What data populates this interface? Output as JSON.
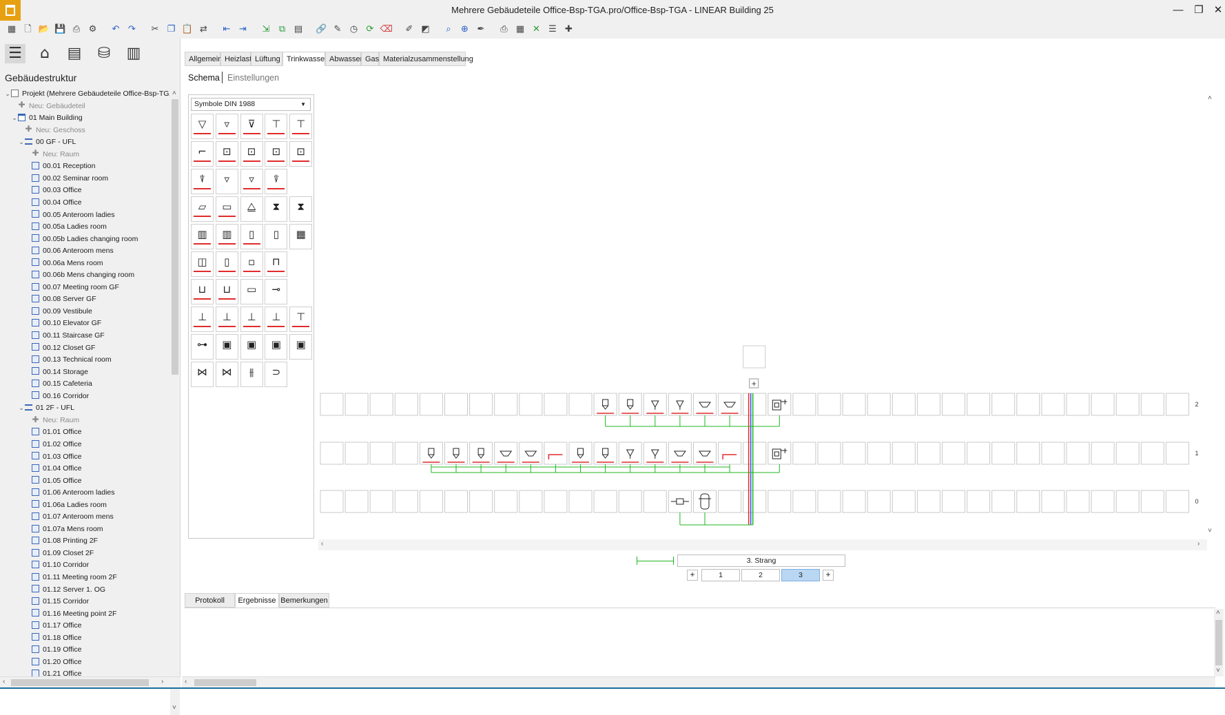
{
  "window": {
    "title": "Mehrere Gebäudeteile Office-Bsp-TGA.pro/Office-Bsp-TGA - LINEAR Building 25",
    "controls": [
      "—",
      "❐",
      "✕"
    ]
  },
  "toolbar": {
    "icons": [
      {
        "name": "apps-grid-icon",
        "glyph": "▦"
      },
      {
        "name": "new-file-icon",
        "glyph": "🗋"
      },
      {
        "name": "open-folder-icon",
        "glyph": "📂"
      },
      {
        "name": "save-icon",
        "glyph": "💾"
      },
      {
        "name": "print-preview-icon",
        "glyph": "⎙"
      },
      {
        "name": "settings-gear-icon",
        "glyph": "⚙"
      },
      {
        "name": "undo-icon",
        "glyph": "↶"
      },
      {
        "name": "redo-icon",
        "glyph": "↷"
      },
      {
        "name": "cut-icon",
        "glyph": "✂"
      },
      {
        "name": "copy-icon",
        "glyph": "❐"
      },
      {
        "name": "paste-icon",
        "glyph": "📋"
      },
      {
        "name": "swap-icon",
        "glyph": "⇄"
      },
      {
        "name": "insert-left-icon",
        "glyph": "⇤"
      },
      {
        "name": "insert-right-icon",
        "glyph": "⇥"
      },
      {
        "name": "export-icon",
        "glyph": "⇲"
      },
      {
        "name": "duplicate-icon",
        "glyph": "⧉"
      },
      {
        "name": "calculate-icon",
        "glyph": "▤"
      },
      {
        "name": "link-icon",
        "glyph": "🔗"
      },
      {
        "name": "edit-pencil-icon",
        "glyph": "✎"
      },
      {
        "name": "history-icon",
        "glyph": "◷"
      },
      {
        "name": "refresh-icon",
        "glyph": "⟳"
      },
      {
        "name": "delete-icon",
        "glyph": "⌫"
      },
      {
        "name": "draw-icon",
        "glyph": "✐"
      },
      {
        "name": "diagram-icon",
        "glyph": "◩"
      },
      {
        "name": "search-icon",
        "glyph": "⌕"
      },
      {
        "name": "zoom-icon",
        "glyph": "⊕"
      },
      {
        "name": "pipette-icon",
        "glyph": "✒"
      },
      {
        "name": "printer-icon",
        "glyph": "⎙"
      },
      {
        "name": "calculator-icon",
        "glyph": "▦"
      },
      {
        "name": "pdf-export-icon",
        "glyph": "✕"
      },
      {
        "name": "report-icon",
        "glyph": "☰"
      },
      {
        "name": "document-add-icon",
        "glyph": "✚"
      }
    ]
  },
  "left_panel": {
    "title": "Gebäudestruktur",
    "tree": [
      {
        "label": "Projekt (Mehrere Gebäudeteile Office-Bsp-TGA)",
        "level": 0,
        "icon": "proj",
        "toggle": "⌄"
      },
      {
        "label": "Neu: Gebäudeteil",
        "level": 1,
        "icon": "plus",
        "gray": true
      },
      {
        "label": "01 Main Building",
        "level": 1,
        "icon": "bld",
        "toggle": "⌄"
      },
      {
        "label": "Neu: Geschoss",
        "level": 2,
        "icon": "plus",
        "gray": true
      },
      {
        "label": "00 GF - UFL",
        "level": 2,
        "icon": "floor",
        "toggle": "⌄"
      },
      {
        "label": "Neu: Raum",
        "level": 3,
        "icon": "plus",
        "gray": true
      },
      {
        "label": "00.01 Reception",
        "level": 3,
        "icon": "room"
      },
      {
        "label": "00.02 Seminar room",
        "level": 3,
        "icon": "room"
      },
      {
        "label": "00.03 Office",
        "level": 3,
        "icon": "room"
      },
      {
        "label": "00.04 Office",
        "level": 3,
        "icon": "room"
      },
      {
        "label": "00.05 Anteroom ladies",
        "level": 3,
        "icon": "room"
      },
      {
        "label": "00.05a Ladies room",
        "level": 3,
        "icon": "room"
      },
      {
        "label": "00.05b Ladies changing room",
        "level": 3,
        "icon": "room"
      },
      {
        "label": "00.06 Anteroom mens",
        "level": 3,
        "icon": "room"
      },
      {
        "label": "00.06a Mens room",
        "level": 3,
        "icon": "room"
      },
      {
        "label": "00.06b Mens changing room",
        "level": 3,
        "icon": "room"
      },
      {
        "label": "00.07 Meeting room GF",
        "level": 3,
        "icon": "room"
      },
      {
        "label": "00.08 Server GF",
        "level": 3,
        "icon": "room"
      },
      {
        "label": "00.09 Vestibule",
        "level": 3,
        "icon": "room"
      },
      {
        "label": "00.10 Elevator GF",
        "level": 3,
        "icon": "room"
      },
      {
        "label": "00.11 Staircase GF",
        "level": 3,
        "icon": "room"
      },
      {
        "label": "00.12 Closet GF",
        "level": 3,
        "icon": "room"
      },
      {
        "label": "00.13 Technical room",
        "level": 3,
        "icon": "room"
      },
      {
        "label": "00.14 Storage",
        "level": 3,
        "icon": "room"
      },
      {
        "label": "00.15 Cafeteria",
        "level": 3,
        "icon": "room"
      },
      {
        "label": "00.16 Corridor",
        "level": 3,
        "icon": "room"
      },
      {
        "label": "01 2F - UFL",
        "level": 2,
        "icon": "floor",
        "toggle": "⌄"
      },
      {
        "label": "Neu: Raum",
        "level": 3,
        "icon": "plus",
        "gray": true
      },
      {
        "label": "01.01 Office",
        "level": 3,
        "icon": "room"
      },
      {
        "label": "01.02 Office",
        "level": 3,
        "icon": "room"
      },
      {
        "label": "01.03 Office",
        "level": 3,
        "icon": "room"
      },
      {
        "label": "01.04 Office",
        "level": 3,
        "icon": "room"
      },
      {
        "label": "01.05 Office",
        "level": 3,
        "icon": "room"
      },
      {
        "label": "01.06 Anteroom ladies",
        "level": 3,
        "icon": "room"
      },
      {
        "label": "01.06a Ladies room",
        "level": 3,
        "icon": "room"
      },
      {
        "label": "01.07 Anteroom mens",
        "level": 3,
        "icon": "room"
      },
      {
        "label": "01.07a Mens room",
        "level": 3,
        "icon": "room"
      },
      {
        "label": "01.08 Printing 2F",
        "level": 3,
        "icon": "room"
      },
      {
        "label": "01.09 Closet 2F",
        "level": 3,
        "icon": "room"
      },
      {
        "label": "01.10 Corridor",
        "level": 3,
        "icon": "room"
      },
      {
        "label": "01.11 Meeting room 2F",
        "level": 3,
        "icon": "room"
      },
      {
        "label": "01.12 Server 1. OG",
        "level": 3,
        "icon": "room"
      },
      {
        "label": "01.15 Corridor",
        "level": 3,
        "icon": "room"
      },
      {
        "label": "01.16 Meeting point 2F",
        "level": 3,
        "icon": "room"
      },
      {
        "label": "01.17 Office",
        "level": 3,
        "icon": "room"
      },
      {
        "label": "01.18 Office",
        "level": 3,
        "icon": "room"
      },
      {
        "label": "01.19 Office",
        "level": 3,
        "icon": "room"
      },
      {
        "label": "01.20 Office",
        "level": 3,
        "icon": "room"
      },
      {
        "label": "01.21 Office",
        "level": 3,
        "icon": "room"
      }
    ]
  },
  "tabs": [
    "Allgemein",
    "Heizlast",
    "Lüftung",
    "Trinkwasser",
    "Abwasser",
    "Gas",
    "Materialzusammenstellung"
  ],
  "active_tab": "Trinkwasser",
  "subtabs": [
    "Schema",
    "Einstellungen"
  ],
  "palette": {
    "select_value": "Symbole DIN 1988",
    "rows": [
      [
        {
          "g": "▽",
          "r": true
        },
        {
          "g": "▿",
          "r": true
        },
        {
          "g": "⊽",
          "r": true
        },
        {
          "g": "⊤",
          "r": true
        },
        {
          "g": "⊤",
          "r": true
        }
      ],
      [
        {
          "g": "⌐",
          "r": true
        },
        {
          "g": "⊡",
          "r": true
        },
        {
          "g": "⊡",
          "r": true
        },
        {
          "g": "⊡",
          "r": true
        },
        {
          "g": "⊡",
          "r": true
        }
      ],
      [
        {
          "g": "⍒",
          "r": true
        },
        {
          "g": "▿",
          "r": false
        },
        {
          "g": "▿",
          "r": true
        },
        {
          "g": "⍒",
          "r": true
        }
      ],
      [
        {
          "g": "⏥",
          "r": true
        },
        {
          "g": "▭",
          "r": true
        },
        {
          "g": "⧋",
          "r": false
        },
        {
          "g": "⧗",
          "r": false
        },
        {
          "g": "⧗",
          "r": false
        }
      ],
      [
        {
          "g": "▥",
          "r": true
        },
        {
          "g": "▥",
          "r": true
        },
        {
          "g": "▯",
          "r": true
        },
        {
          "g": "▯",
          "r": false
        },
        {
          "g": "▦",
          "r": false
        }
      ],
      [
        {
          "g": "◫",
          "r": true
        },
        {
          "g": "▯",
          "r": true
        },
        {
          "g": "▫",
          "r": true
        },
        {
          "g": "⊓",
          "r": true
        }
      ],
      [
        {
          "g": "⊔",
          "r": true
        },
        {
          "g": "⊔",
          "r": true
        },
        {
          "g": "▭",
          "r": false
        },
        {
          "g": "⊸",
          "r": false
        }
      ],
      [
        {
          "g": "⊥",
          "r": true
        },
        {
          "g": "⊥",
          "r": true
        },
        {
          "g": "⊥",
          "r": true
        },
        {
          "g": "⊥",
          "r": true
        },
        {
          "g": "⊤",
          "r": true
        }
      ],
      [
        {
          "g": "⊶",
          "r": false
        },
        {
          "g": "▣",
          "r": false
        },
        {
          "g": "▣",
          "r": false
        },
        {
          "g": "▣",
          "r": false
        },
        {
          "g": "▣",
          "r": false
        }
      ],
      [
        {
          "g": "⋈",
          "r": false
        },
        {
          "g": "⋈",
          "r": false
        },
        {
          "g": "⫵",
          "r": false
        },
        {
          "g": "⊃",
          "r": false
        }
      ]
    ]
  },
  "schematic": {
    "floor_labels": [
      "2",
      "1",
      "0"
    ],
    "plus_label": "+",
    "rows": [
      {
        "slots": {
          "11": "tap",
          "12": "tap",
          "13": "valve",
          "14": "valve",
          "15": "sink",
          "16": "sink",
          "18": "heater"
        }
      },
      {
        "slots": {
          "4": "tap",
          "5": "tap",
          "6": "tap",
          "7": "sink",
          "8": "sink",
          "9": "ell",
          "10": "tap",
          "11": "tap",
          "12": "valve",
          "13": "valve",
          "14": "sink",
          "15": "sink",
          "16": "ell",
          "18": "heater"
        }
      },
      {
        "slots": {
          "14": "meter",
          "15": "storage"
        }
      }
    ]
  },
  "strang": {
    "name": "3. Strang",
    "options": [
      "1",
      "2",
      "3"
    ],
    "active": "3",
    "plus": "+"
  },
  "bottom_tabs": [
    "Protokoll",
    "Ergebnisse",
    "Bemerkungen"
  ],
  "bottom_active": "Ergebnisse",
  "colors": {
    "cold": "#1fb61f",
    "hot": "#e02b2b",
    "return": "#2a52d8",
    "accent": "#e8a013"
  }
}
